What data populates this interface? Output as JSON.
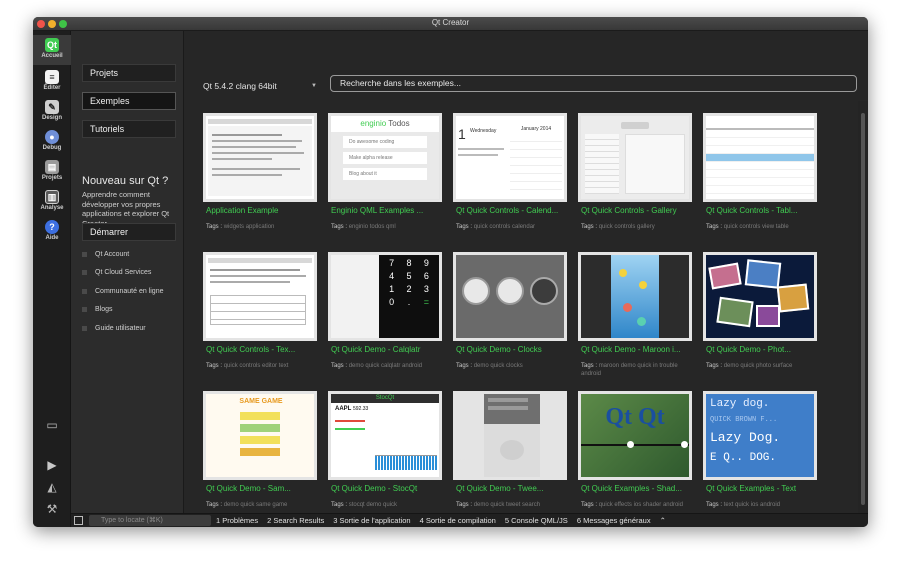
{
  "window": {
    "title": "Qt Creator"
  },
  "modes": [
    {
      "label": "Accueil",
      "icon": "qt-logo-icon",
      "active": true
    },
    {
      "label": "Éditer",
      "icon": "edit-document-icon"
    },
    {
      "label": "Design",
      "icon": "design-pen-icon"
    },
    {
      "label": "Debug",
      "icon": "debug-bug-icon"
    },
    {
      "label": "Projets",
      "icon": "projects-wrench-icon"
    },
    {
      "label": "Analyse",
      "icon": "analyze-icon"
    },
    {
      "label": "Aide",
      "icon": "help-icon"
    }
  ],
  "tools": [
    "kit-selector-icon",
    "run-icon",
    "debug-run-icon",
    "build-hammer-icon"
  ],
  "left_panel": {
    "buttons": [
      "Projets",
      "Exemples",
      "Tutoriels"
    ],
    "new_title": "Nouveau sur Qt ?",
    "new_text": "Apprendre comment développer vos propres applications et explorer Qt Creator.",
    "start_button": "Démarrer",
    "links": [
      "Qt Account",
      "Qt Cloud Services",
      "Communauté en ligne",
      "Blogs",
      "Guide utilisateur"
    ]
  },
  "toolbar": {
    "version": "Qt 5.4.2 clang 64bit",
    "search_placeholder": "Recherche dans les exemples..."
  },
  "tags_label": "Tags :",
  "examples": [
    {
      "title": "Application Example",
      "tags": "widgets application"
    },
    {
      "title": "Enginio QML Examples ...",
      "tags": "enginio todos qml"
    },
    {
      "title": "Qt Quick Controls - Calend...",
      "tags": "quick controls calendar"
    },
    {
      "title": "Qt Quick Controls - Gallery",
      "tags": "quick controls gallery"
    },
    {
      "title": "Qt Quick Controls - Tabl...",
      "tags": "quick controls view table"
    },
    {
      "title": "Qt Quick Controls - Tex...",
      "tags": "quick controls editor text"
    },
    {
      "title": "Qt Quick Demo - Calqlatr",
      "tags": "demo quick calqlatr android"
    },
    {
      "title": "Qt Quick Demo - Clocks",
      "tags": "demo quick clocks"
    },
    {
      "title": "Qt Quick Demo - Maroon i...",
      "tags": "maroon demo quick in trouble android"
    },
    {
      "title": "Qt Quick Demo - Phot...",
      "tags": "demo quick photo surface"
    },
    {
      "title": "Qt Quick Demo - Sam...",
      "tags": "demo quick same game"
    },
    {
      "title": "Qt Quick Demo - StocQt",
      "tags": "stocqt demo quick"
    },
    {
      "title": "Qt Quick Demo - Twee...",
      "tags": "demo quick tweet search"
    },
    {
      "title": "Qt Quick Examples - Shad...",
      "tags": "quick effects ios shader android"
    },
    {
      "title": "Qt Quick Examples - Text",
      "tags": "text quick ios android"
    }
  ],
  "thumb_text": {
    "enginio_title": "Todos",
    "enginio_brand": "enginio",
    "enginio_items": [
      "Do awesome coding",
      "Make alpha release",
      "Blog about it"
    ],
    "calendar_day": "1",
    "calendar_weekday": "Wednesday",
    "calendar_month": "January 2014",
    "calc_keys": [
      "7",
      "8",
      "9",
      "4",
      "5",
      "6",
      "1",
      "2",
      "3",
      "0",
      ".",
      "="
    ],
    "stock_symbol": "AAPL",
    "stock_price": "592.33",
    "stock_title": "StocQt",
    "shader_text": "Qt Qt",
    "text_lines": [
      "Lazy dog.",
      "QUICK BROWN F...",
      "Lazy Dog.",
      "E Q.. DOG."
    ],
    "samegame_title": "SAME GAME"
  },
  "status": {
    "locate_placeholder": "Type to locate (⌘K)",
    "tabs": [
      "1  Problèmes",
      "2  Search Results",
      "3  Sortie de l'application",
      "4  Sortie de compilation",
      "5  Console QML/JS",
      "6  Messages généraux"
    ]
  }
}
